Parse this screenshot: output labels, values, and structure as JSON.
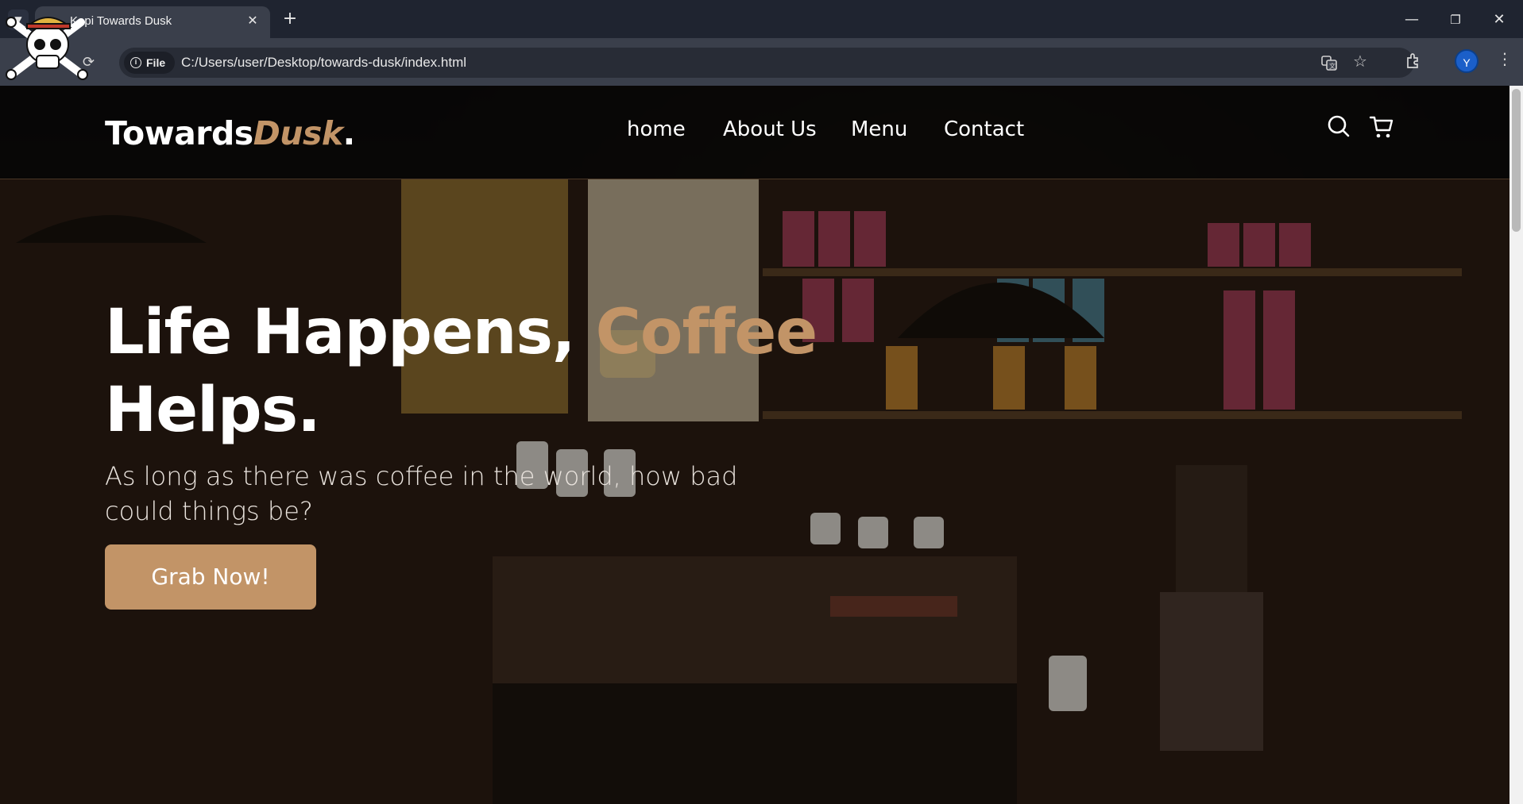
{
  "browser": {
    "tab_title": "Kopi Towards Dusk",
    "tab_close": "✕",
    "new_tab": "+",
    "file_chip": "File",
    "url": "C:/Users/user/Desktop/towards-dusk/index.html",
    "profile_initial": "Y",
    "window_controls": [
      "—",
      "❐",
      "✕"
    ]
  },
  "site": {
    "logo": {
      "main": "Towards",
      "accent": "Dusk",
      "dot": "."
    },
    "nav": [
      "home",
      "About Us",
      "Menu",
      "Contact"
    ],
    "hero": {
      "title_line1_main": "Life Happens, ",
      "title_line1_accent": "Coffee",
      "title_line2": "Helps.",
      "subtitle": "As long as there was coffee in the world, how bad could things be?",
      "cta": "Grab Now!"
    },
    "colors": {
      "accent": "#c29467",
      "header_bg": "#050505",
      "text": "#ffffff"
    },
    "icons": [
      "search-icon",
      "cart-icon"
    ]
  }
}
